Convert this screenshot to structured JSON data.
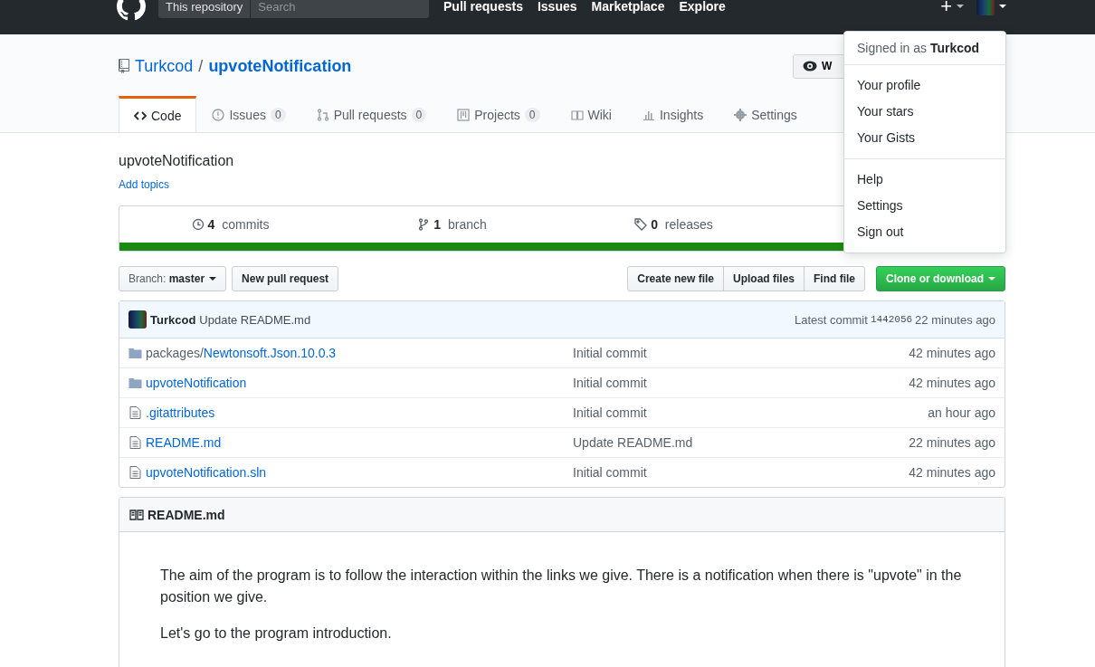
{
  "header": {
    "scope": "This repository",
    "search": {
      "placeholder": "Search"
    },
    "nav": [
      "Pull requests",
      "Issues",
      "Marketplace",
      "Explore"
    ],
    "plus": "+"
  },
  "repo": {
    "owner": "Turkcod",
    "separator": "/",
    "name": "upvoteNotification",
    "watch": "W"
  },
  "tabs": [
    {
      "label": "Code",
      "selected": true
    },
    {
      "label": "Issues",
      "count": "0",
      "selected": false
    },
    {
      "label": "Pull requests",
      "count": "0",
      "selected": false
    },
    {
      "label": "Projects",
      "count": "0",
      "selected": false
    },
    {
      "label": "Wiki",
      "selected": false
    },
    {
      "label": "Insights",
      "selected": false
    },
    {
      "label": "Settings",
      "selected": false
    }
  ],
  "description": "upvoteNotification",
  "add_topics": "Add topics",
  "stats": [
    {
      "number": "4",
      "label": "commits"
    },
    {
      "number": "1",
      "label": "branch"
    },
    {
      "number": "0",
      "label": "releases"
    }
  ],
  "branch_button": {
    "label": "Branch:",
    "value": "master"
  },
  "new_pr": "New pull request",
  "file_buttons": [
    "Create new file",
    "Upload files",
    "Find file"
  ],
  "clone_button": "Clone or download",
  "latest_commit": {
    "author": "Turkcod",
    "message": "Update README.md",
    "label": "Latest commit",
    "sha": "1442056",
    "age": "22 minutes ago"
  },
  "files": [
    {
      "kind": "dir",
      "prefix": "packages/",
      "name": "Newtonsoft.Json.10.0.3",
      "message": "Initial commit",
      "age": "42 minutes ago"
    },
    {
      "kind": "dir",
      "name": "upvoteNotification",
      "message": "Initial commit",
      "age": "42 minutes ago"
    },
    {
      "kind": "file",
      "name": ".gitattributes",
      "message": "Initial commit",
      "age": "an hour ago"
    },
    {
      "kind": "file",
      "name": "README.md",
      "message": "Update README.md",
      "age": "22 minutes ago"
    },
    {
      "kind": "file",
      "name": "upvoteNotification.sln",
      "message": "Initial commit",
      "age": "42 minutes ago"
    }
  ],
  "readme": {
    "title": "README.md",
    "paragraphs": [
      "The aim of the program is to follow the interaction within the links we give. There is a notification when there is \"upvote\" in the position we give.",
      "Let's go to the program introduction."
    ]
  },
  "user_menu": {
    "signed_in": "Signed in as **Turkcod**",
    "groups": [
      [
        "Your profile",
        "Your stars",
        "Your Gists"
      ],
      [
        "Help",
        "Settings",
        "Sign out"
      ]
    ]
  }
}
